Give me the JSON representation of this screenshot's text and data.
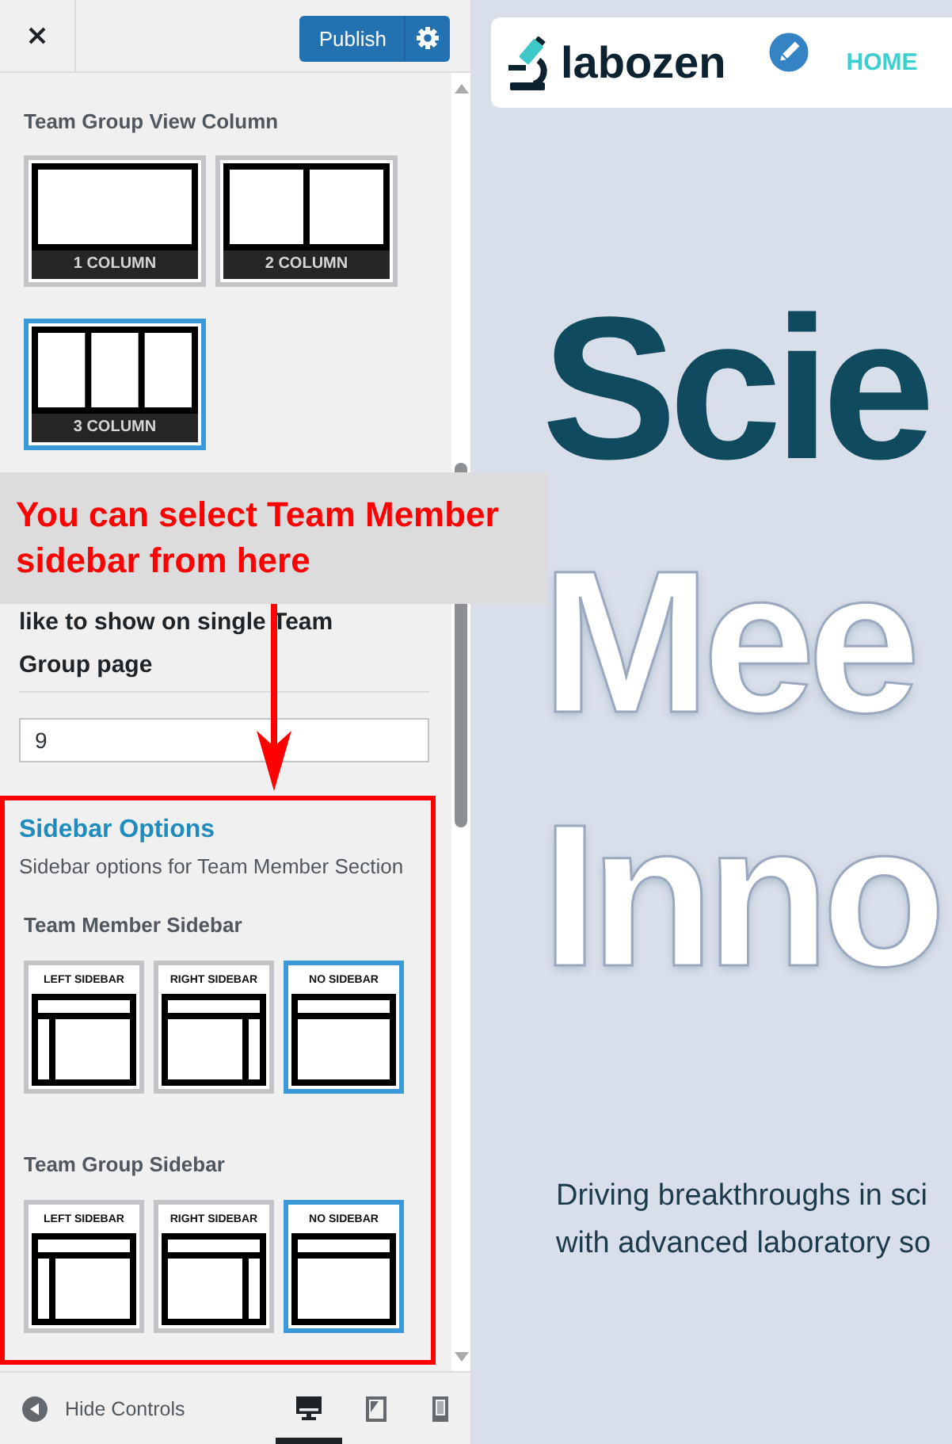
{
  "header": {
    "publish": "Publish"
  },
  "team_group_view_column": {
    "title": "Team Group View Column",
    "options": [
      {
        "label": "1 COLUMN",
        "kind": "single",
        "selected": false
      },
      {
        "label": "2 COLUMN",
        "kind": "double",
        "selected": false
      },
      {
        "label": "3 COLUMN",
        "kind": "triple",
        "selected": true
      }
    ]
  },
  "annotation": {
    "text": "You can select Team Member sidebar from here"
  },
  "posts_per_page": {
    "label": "like to show on single Team Group page",
    "value": "9"
  },
  "sidebar_options": {
    "title": "Sidebar Options",
    "description": "Sidebar options for Team Member Section",
    "controls": [
      {
        "title": "Team Member Sidebar",
        "options": [
          {
            "label": "LEFT SIDEBAR",
            "kind": "left",
            "selected": false
          },
          {
            "label": "RIGHT SIDEBAR",
            "kind": "right",
            "selected": false
          },
          {
            "label": "NO SIDEBAR",
            "kind": "none",
            "selected": true
          }
        ]
      },
      {
        "title": "Team Group Sidebar",
        "options": [
          {
            "label": "LEFT SIDEBAR",
            "kind": "left",
            "selected": false
          },
          {
            "label": "RIGHT SIDEBAR",
            "kind": "right",
            "selected": false
          },
          {
            "label": "NO SIDEBAR",
            "kind": "none",
            "selected": true
          }
        ]
      }
    ]
  },
  "footer": {
    "hide_controls": "Hide Controls",
    "devices": [
      {
        "kind": "desktop",
        "selected": true
      },
      {
        "kind": "tablet",
        "selected": false
      },
      {
        "kind": "mobile",
        "selected": false
      }
    ]
  },
  "preview": {
    "logo": "labozen",
    "nav": [
      {
        "label": "HOME",
        "selected": true
      }
    ],
    "hero": {
      "heading": [
        {
          "text": "Scie",
          "kind": "accent"
        },
        {
          "text": "Mee",
          "kind": "plain"
        },
        {
          "text": "Inno",
          "kind": "plain"
        }
      ],
      "subtitle": [
        "Driving breakthroughs in sci",
        "with advanced laboratory so"
      ]
    }
  }
}
